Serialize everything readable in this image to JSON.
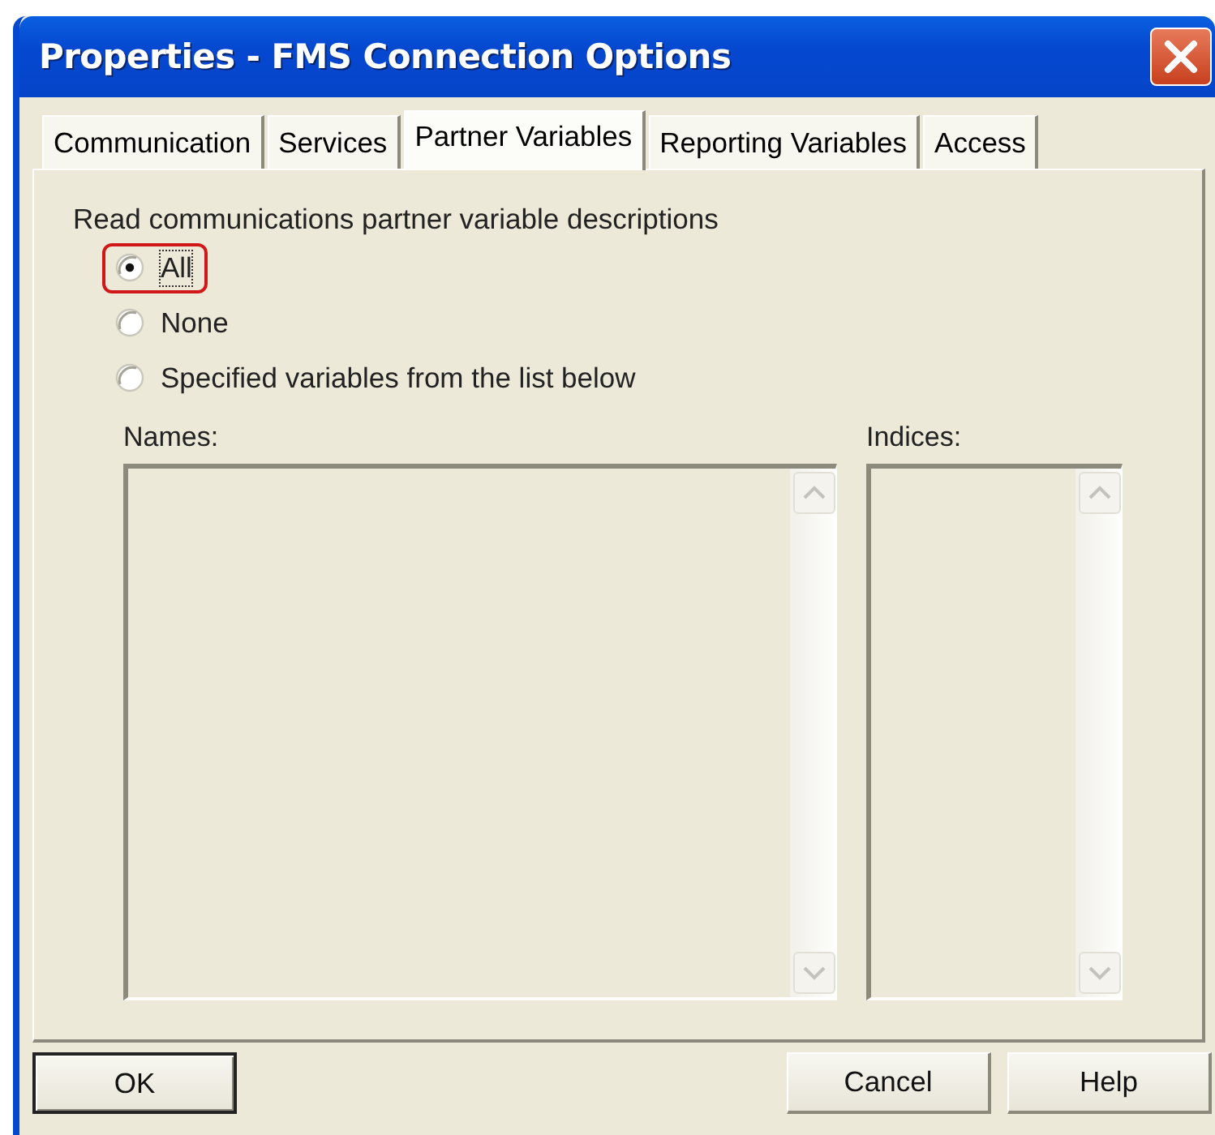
{
  "window": {
    "title": "Properties - FMS Connection Options"
  },
  "tabs": [
    {
      "label": "Communication",
      "selected": false
    },
    {
      "label": "Services",
      "selected": false
    },
    {
      "label": "Partner Variables",
      "selected": true
    },
    {
      "label": "Reporting Variables",
      "selected": false
    },
    {
      "label": "Access",
      "selected": false
    }
  ],
  "group_label": "Read communications partner variable descriptions",
  "options": [
    {
      "label": "All",
      "selected": true,
      "highlighted": true
    },
    {
      "label": "None",
      "selected": false,
      "highlighted": false
    },
    {
      "label": "Specified variables from the list below",
      "selected": false,
      "highlighted": false
    }
  ],
  "lists": [
    {
      "label": "Names:",
      "disabled": true
    },
    {
      "label": "Indices:",
      "disabled": true
    }
  ],
  "buttons": [
    {
      "label": "OK",
      "default": true
    },
    {
      "label": "Cancel",
      "default": false
    },
    {
      "label": "Help",
      "default": false
    }
  ]
}
